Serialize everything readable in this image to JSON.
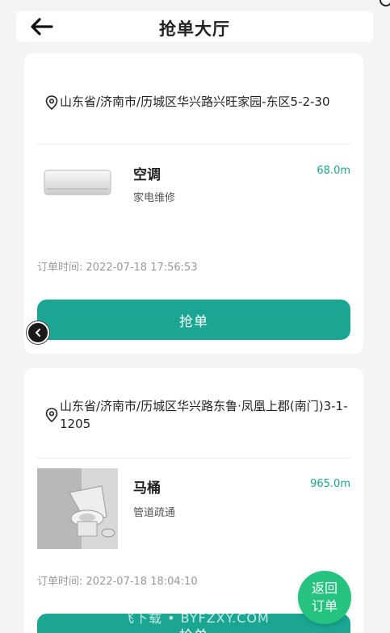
{
  "header": {
    "title": "抢单大厅",
    "back_icon": "arrow-left-icon"
  },
  "orders": [
    {
      "address": "山东省/济南市/历城区华兴路兴旺家园-东区5-2-30",
      "item_name": "空调",
      "service_type": "家电维修",
      "distance": "68.0m",
      "order_time_label": "订单时间:",
      "order_time": "2022-07-18 17:56:53",
      "button_label": "抢单"
    },
    {
      "address": "山东省/济南市/历城区华兴路东鲁·凤凰上郡(南门)3-1-1205",
      "item_name": "马桶",
      "service_type": "管道疏通",
      "distance": "965.0m",
      "order_time_label": "订单时间:",
      "order_time": "2022-07-18 18:04:10",
      "button_label": "抢单"
    }
  ],
  "return_button": {
    "line1": "返回",
    "line2": "订单"
  },
  "watermark": "飞下载 • BYFZXY.COM",
  "colors": {
    "accent": "#1aa693",
    "return": "#25c37f"
  }
}
